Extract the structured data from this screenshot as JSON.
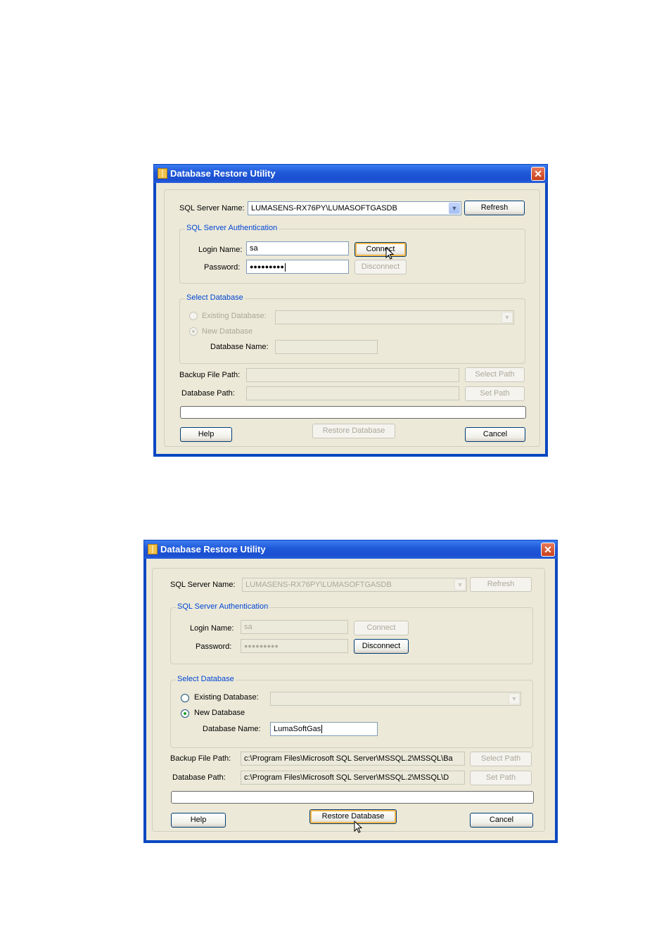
{
  "dialog1": {
    "title": "Database Restore Utility",
    "close_glyph": "✕",
    "server_label": "SQL Server Name:",
    "server_value": "LUMASENS-RX76PY\\LUMASOFTGASDB",
    "refresh_label": "Refresh",
    "auth_group": "SQL Server Authentication",
    "login_label": "Login Name:",
    "login_value": "sa",
    "password_label": "Password:",
    "password_value": "●●●●●●●●●",
    "connect_label": "Connect",
    "disconnect_label": "Disconnect",
    "select_group": "Select Database",
    "existing_label": "Existing Database:",
    "new_label": "New Database",
    "dbname_label": "Database Name:",
    "dbname_value": "",
    "backup_label": "Backup File Path:",
    "backup_value": "",
    "select_path_label": "Select Path",
    "dbpath_label": "Database Path:",
    "dbpath_value": "",
    "set_path_label": "Set Path",
    "help_label": "Help",
    "restore_label": "Restore Database",
    "cancel_label": "Cancel"
  },
  "dialog2": {
    "title": "Database Restore Utility",
    "close_glyph": "✕",
    "server_label": "SQL Server Name:",
    "server_value": "LUMASENS-RX76PY\\LUMASOFTGASDB",
    "refresh_label": "Refresh",
    "auth_group": "SQL Server Authentication",
    "login_label": "Login Name:",
    "login_value": "sa",
    "password_label": "Password:",
    "password_value": "●●●●●●●●●",
    "connect_label": "Connect",
    "disconnect_label": "Disconnect",
    "select_group": "Select Database",
    "existing_label": "Existing Database:",
    "new_label": "New Database",
    "dbname_label": "Database Name:",
    "dbname_value": "LumaSoftGas",
    "backup_label": "Backup File Path:",
    "backup_value": "c:\\Program Files\\Microsoft SQL Server\\MSSQL.2\\MSSQL\\Ba",
    "select_path_label": "Select Path",
    "dbpath_label": "Database Path:",
    "dbpath_value": "c:\\Program Files\\Microsoft SQL Server\\MSSQL.2\\MSSQL\\D",
    "set_path_label": "Set Path",
    "help_label": "Help",
    "restore_label": "Restore Database",
    "cancel_label": "Cancel"
  },
  "icons": {
    "app": "app-icon",
    "close": "close-icon",
    "dropdown": "chevron-down-icon",
    "cursor": "mouse-pointer-icon"
  }
}
